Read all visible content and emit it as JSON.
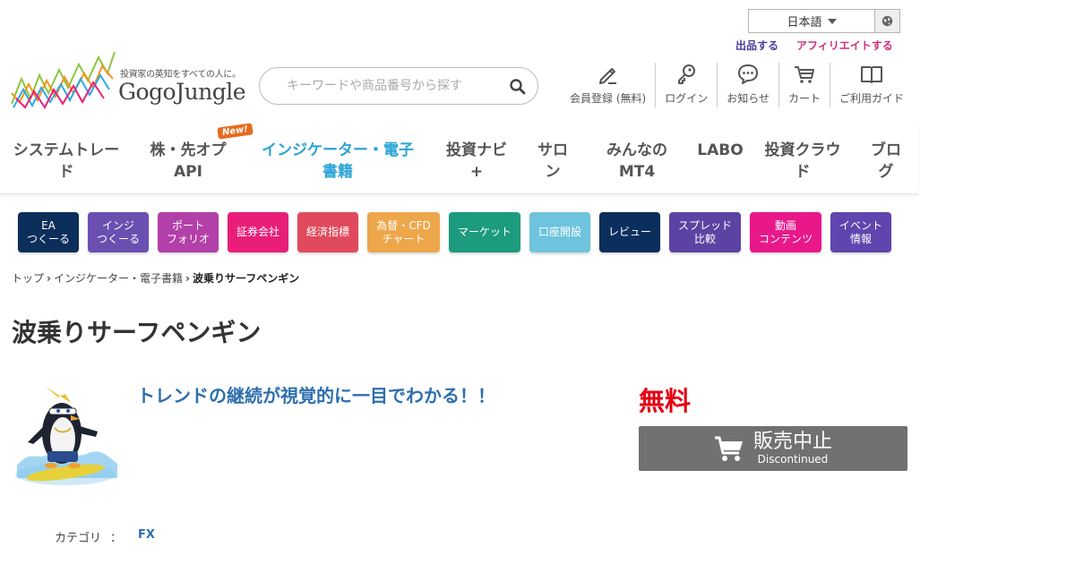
{
  "header": {
    "language": "日本語",
    "link_sell": "出品する",
    "link_affiliate": "アフィリエイトする",
    "logo_tagline": "投資家の英知をすべての人に。",
    "logo_name": "GogoJungle",
    "search_placeholder": "キーワードや商品番号から探す",
    "util_nav": [
      "会員登録 (無料)",
      "ログイン",
      "お知らせ",
      "カート",
      "ご利用ガイド"
    ]
  },
  "main_nav": {
    "items": [
      "システムトレード",
      "株・先オプAPI",
      "インジケーター・電子書籍",
      "投資ナビ+",
      "サロン",
      "みんなのMT4",
      "LABO",
      "投資クラウド",
      "ブログ"
    ],
    "new_badge": "New!"
  },
  "categories": [
    {
      "label": "EA\nつくーる",
      "color": "#0b2e5a"
    },
    {
      "label": "インジ\nつくーる",
      "color": "#6a4fb0"
    },
    {
      "label": "ポート\nフォリオ",
      "color": "#b33fa8"
    },
    {
      "label": "証券会社",
      "color": "#e81e79"
    },
    {
      "label": "経済指標",
      "color": "#e04a5c"
    },
    {
      "label": "為替・CFD\nチャート",
      "color": "#eea64b"
    },
    {
      "label": "マーケット",
      "color": "#1d9b7f"
    },
    {
      "label": "口座開設",
      "color": "#6ec4dc"
    },
    {
      "label": "レビュー",
      "color": "#0a2f5c"
    },
    {
      "label": "スプレッド\n比較",
      "color": "#5c43a3"
    },
    {
      "label": "動画\nコンテンツ",
      "color": "#e8188a"
    },
    {
      "label": "イベント\n情報",
      "color": "#5f45ad"
    }
  ],
  "breadcrumb": [
    "トップ",
    "インジケーター・電子書籍",
    "波乗りサーフペンギン"
  ],
  "product": {
    "title": "波乗りサーフペンギン",
    "catchphrase": "トレンドの継続が視覚的に一目でわかる！！",
    "price": "無料",
    "buy_main": "販売中止",
    "buy_sub": "Discontinued",
    "category_label": "カテゴリ",
    "category_sep": "：",
    "category_value": "FX"
  }
}
